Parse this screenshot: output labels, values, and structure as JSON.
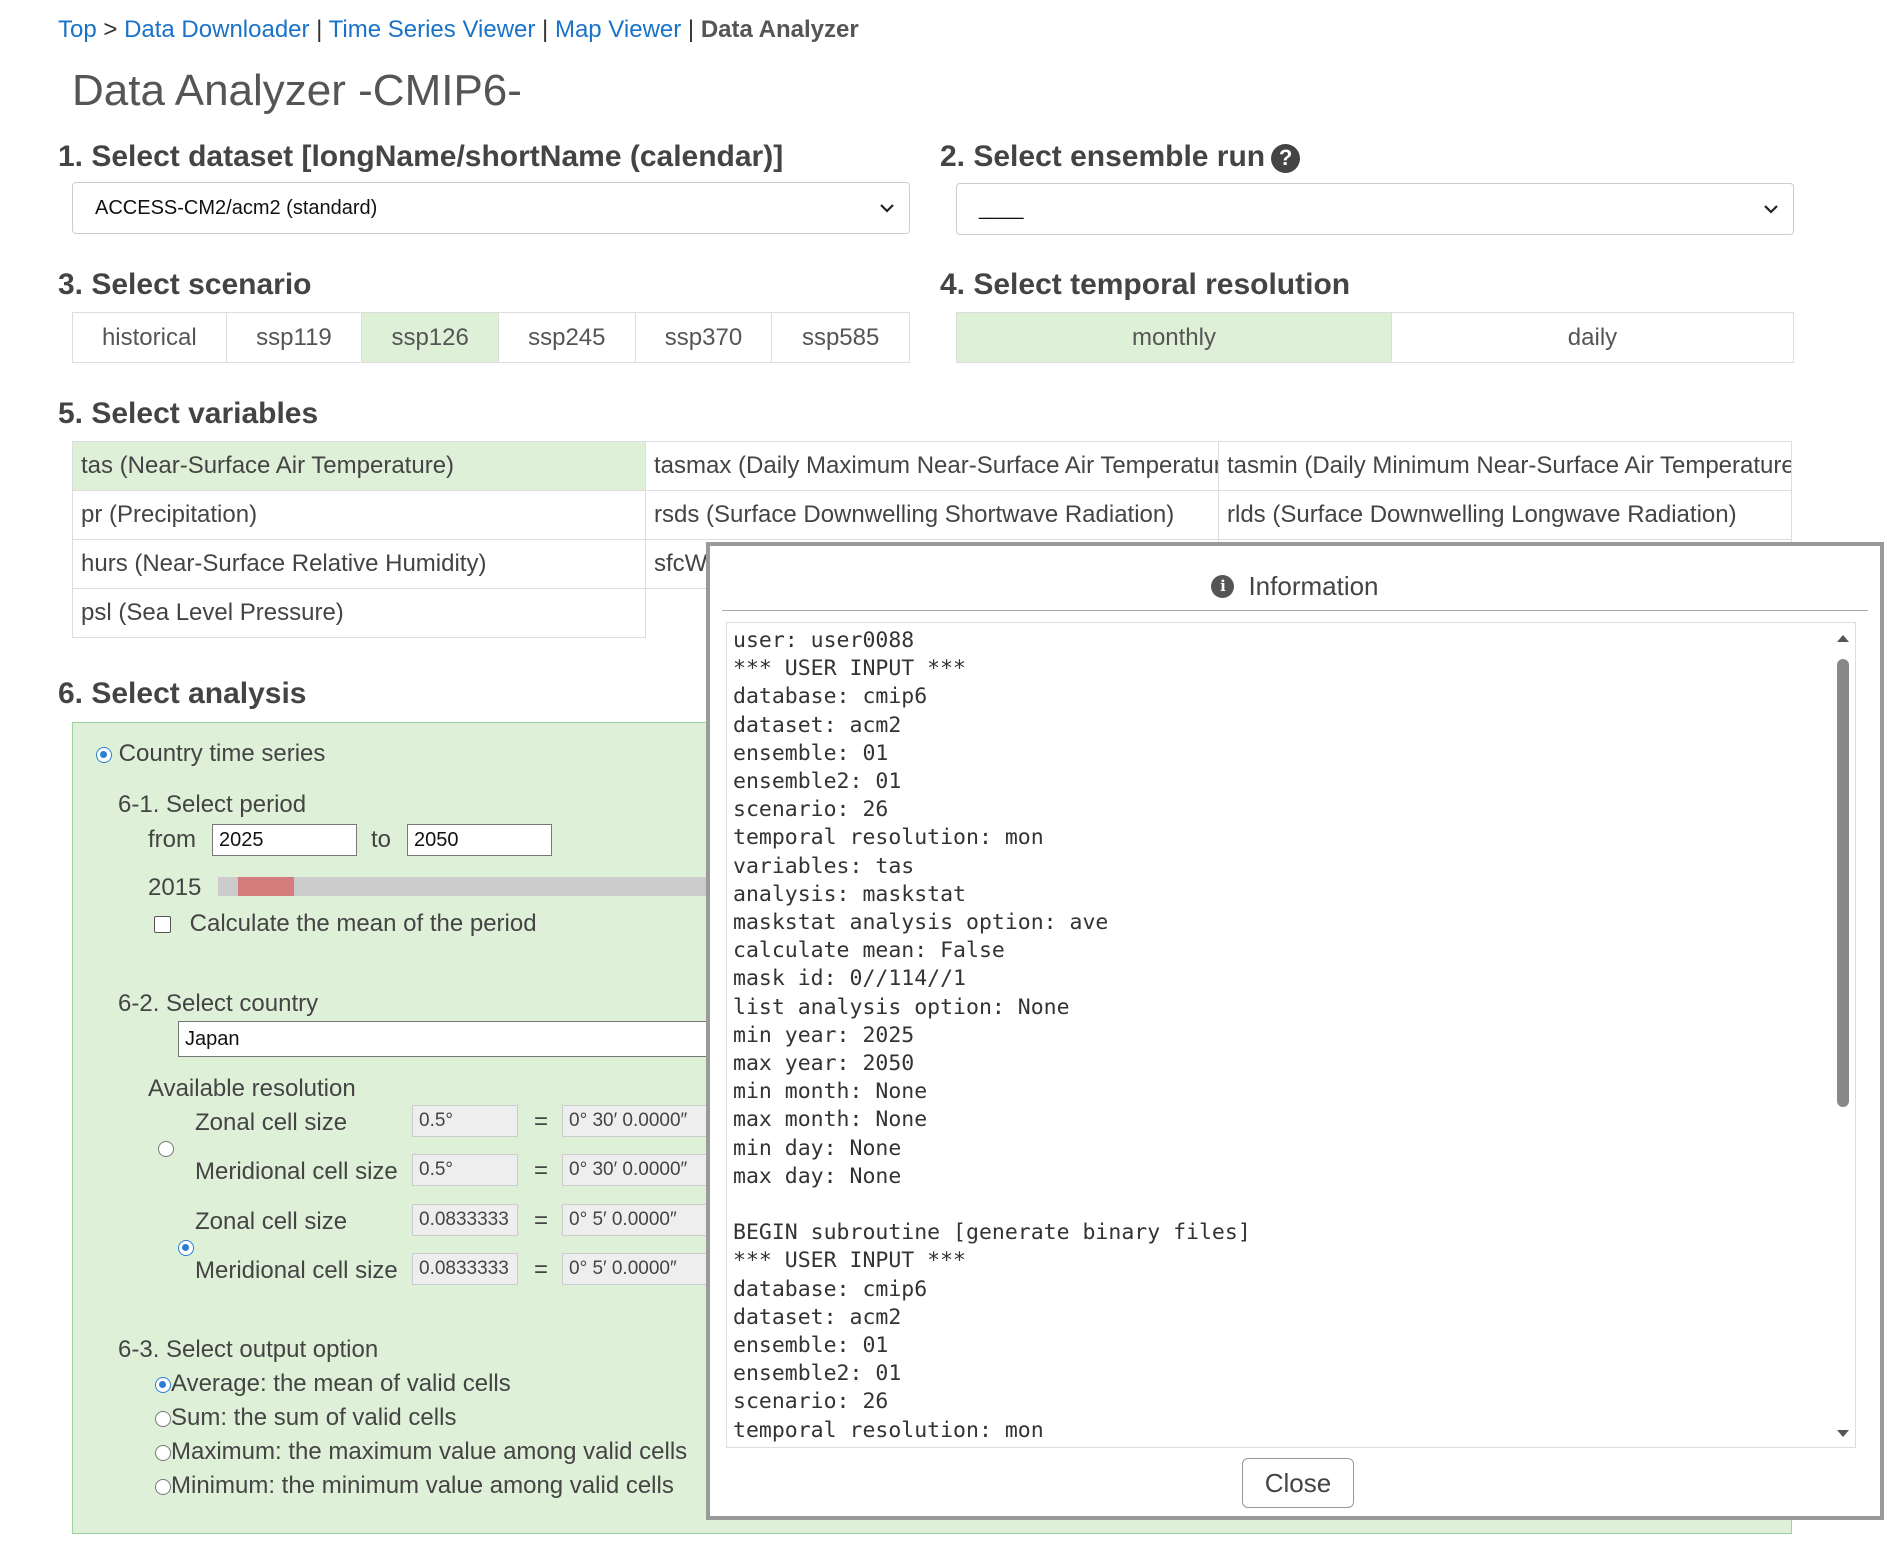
{
  "breadcrumb": {
    "top": "Top",
    "sep1": ">",
    "downloader": "Data Downloader",
    "sep2": "|",
    "ts_viewer": "Time Series Viewer",
    "sep3": "|",
    "map_viewer": "Map Viewer",
    "sep4": "|",
    "current": "Data Analyzer"
  },
  "page_title": "Data Analyzer -CMIP6-",
  "dataset": {
    "title": "1. Select dataset [longName/shortName (calendar)]",
    "selected": "ACCESS-CM2/acm2 (standard)"
  },
  "ensemble": {
    "title": "2. Select ensemble run",
    "selected": "____"
  },
  "scenario": {
    "title": "3. Select scenario",
    "options": [
      "historical",
      "ssp119",
      "ssp126",
      "ssp245",
      "ssp370",
      "ssp585"
    ],
    "selected": "ssp126"
  },
  "temporal": {
    "title": "4. Select temporal resolution",
    "options": [
      "monthly",
      "daily"
    ],
    "selected": "monthly"
  },
  "variables": {
    "title": "5. Select variables",
    "items": [
      "tas (Near-Surface Air Temperature)",
      "tasmax (Daily Maximum Near-Surface Air Temperature)",
      "tasmin (Daily Minimum Near-Surface Air Temperature)",
      "pr (Precipitation)",
      "rsds (Surface Downwelling Shortwave Radiation)",
      "rlds (Surface Downwelling Longwave Radiation)",
      "hurs (Near-Surface Relative Humidity)",
      "sfcW",
      "",
      "psl (Sea Level Pressure)"
    ],
    "selected": "tas (Near-Surface Air Temperature)"
  },
  "analysis": {
    "title": "6. Select analysis",
    "option_label": "Country time series",
    "period": {
      "title": "6-1. Select period",
      "from_label": "from",
      "from_value": "2025",
      "to_label": "to",
      "to_value": "2050",
      "slider_start": "2015",
      "mean_label": "Calculate the mean of the period"
    },
    "country": {
      "title": "6-2. Select country",
      "value": "Japan",
      "res_title": "Available resolution",
      "rows": [
        {
          "label": "Zonal cell size",
          "value": "0.5°",
          "eq": "=",
          "dms": "0° 30′ 0.0000″"
        },
        {
          "label": "Meridional cell size",
          "value": "0.5°",
          "eq": "=",
          "dms": "0° 30′ 0.0000″"
        },
        {
          "label": "Zonal cell size",
          "value": "0.0833333",
          "eq": "=",
          "dms": "0° 5′ 0.0000″"
        },
        {
          "label": "Meridional cell size",
          "value": "0.0833333",
          "eq": "=",
          "dms": "0° 5′ 0.0000″"
        }
      ]
    },
    "output": {
      "title": "6-3. Select output option",
      "options": [
        "Average: the mean of valid cells",
        "Sum: the sum of valid cells",
        "Maximum: the maximum value among valid cells",
        "Minimum: the minimum value among valid cells"
      ]
    }
  },
  "dialog": {
    "title": "Information",
    "log": "user: user0088\n*** USER INPUT ***\ndatabase: cmip6\ndataset: acm2\nensemble: 01\nensemble2: 01\nscenario: 26\ntemporal resolution: mon\nvariables: tas\nanalysis: maskstat\nmaskstat analysis option: ave\ncalculate mean: False\nmask id: 0//114//1\nlist analysis option: None\nmin year: 2025\nmax year: 2050\nmin month: None\nmax month: None\nmin day: None\nmax day: None\n\nBEGIN subroutine [generate binary files]\n*** USER INPUT ***\ndatabase: cmip6\ndataset: acm2\nensemble: 01\nensemble2: 01\nscenario: 26\ntemporal resolution: mon",
    "close_label": "Close"
  }
}
